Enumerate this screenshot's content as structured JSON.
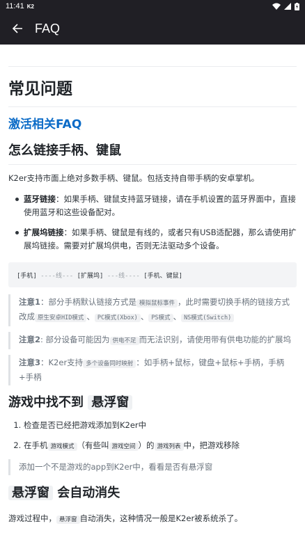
{
  "status": {
    "time": "11:41",
    "app": "K2"
  },
  "appbar": {
    "title": "FAQ"
  },
  "page_title": "常见问题",
  "section_link": "激活相关FAQ",
  "h_connect": "怎么链接手柄、键鼠",
  "intro": "K2er支持市面上绝对多数手柄、键鼠。包括支持自带手柄的安卓掌机。",
  "bullet1": {
    "label": "蓝牙链接",
    "text": "：如果手柄、键鼠支持蓝牙链接，请在手机设置的蓝牙界面中，直接使用蓝牙和这些设备配对。"
  },
  "bullet2": {
    "label": "扩展坞链接",
    "text": "：如果手柄、键鼠是有线的，或者只有USB适配器，那么请使用扩展坞链接。需要对扩展坞供电，否则无法驱动多个设备。"
  },
  "code": {
    "part1": "[手机]",
    "dash1": "----线---",
    "part2": "[扩展坞]",
    "dash2": "---线----",
    "part3": "[手机、键鼠]"
  },
  "note1": {
    "label": "注意1",
    "text_a": "：部分手柄默认链接方式是",
    "code_a": "模拟鼠标事件",
    "text_b": "，此时需要切换手柄的链接方式改成",
    "code_b": "原生安卓HID模式",
    "sep1": "、",
    "code_c": "PC模式(Xbox)",
    "sep2": "、",
    "code_d": "PS模式",
    "sep3": "、",
    "code_e": "NS模式(Switch)"
  },
  "note2": {
    "label": "注意2",
    "text_a": ": 部分设备可能因为",
    "code_a": "供电不足",
    "text_b": "而无法识别，请使用带有供电功能的扩展坞"
  },
  "note3": {
    "label": "注意3",
    "text_a": "：K2er支持",
    "code_a": "多个设备同时映射",
    "text_b": "：如手柄+鼠标，键盘+鼠标+手柄，手柄+手柄"
  },
  "h_float": {
    "pre": "游戏中找不到 ",
    "code": "悬浮窗"
  },
  "steps": {
    "s1": "检查是否已经把游戏添加到K2er中",
    "s2_a": "在手机",
    "s2_code1": "游戏模式",
    "s2_b": "（有些叫",
    "s2_code2": "游戏空间",
    "s2_c": "）的",
    "s2_code3": "游戏列表",
    "s2_d": "中，把游戏移除"
  },
  "tip": "添加一个不是游戏的app到K2er中，看看是否有悬浮窗",
  "h_vanish": {
    "code": "悬浮窗",
    "post": " 会自动消失"
  },
  "vanish_para": {
    "pre": "游戏过程中，",
    "code": "悬浮窗",
    "post": "自动消失，这种情况一般是K2er被系统杀了。"
  }
}
